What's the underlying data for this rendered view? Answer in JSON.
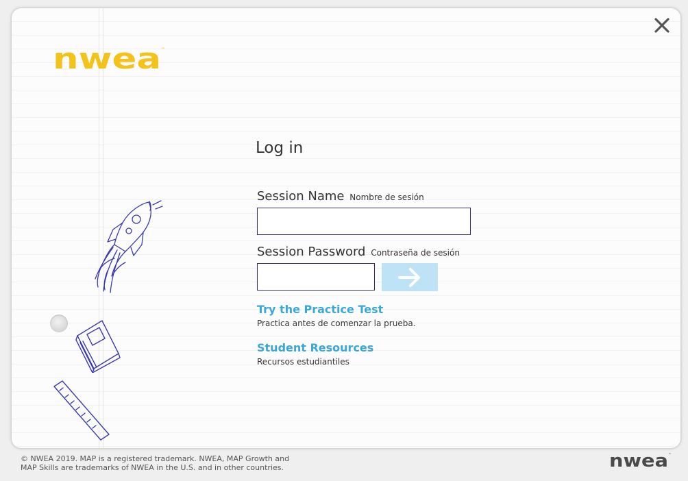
{
  "brand": {
    "logo_text": "nwea",
    "accent_color": "#f3c31c"
  },
  "login": {
    "title": "Log in",
    "session_name": {
      "label": "Session Name",
      "sub_label": "Nombre de sesión",
      "value": ""
    },
    "session_password": {
      "label": "Session Password",
      "sub_label": "Contraseña de sesión",
      "value": ""
    },
    "submit": {
      "icon": "arrow-right-icon",
      "color": "#bee3f6"
    }
  },
  "links": {
    "practice": {
      "label": "Try the Practice Test",
      "sub": "Practica antes de comenzar la prueba.",
      "color": "#3aa8d6"
    },
    "resources": {
      "label": "Student Resources",
      "sub": "Recursos estudiantiles",
      "color": "#3aa8d6"
    }
  },
  "window": {
    "close_icon": "close-icon"
  },
  "footer": {
    "line1": "© NWEA 2019. MAP is a registered trademark. NWEA, MAP Growth and",
    "line2": "MAP Skills are trademarks of NWEA in the U.S. and in other countries.",
    "logo_text": "nwea"
  }
}
